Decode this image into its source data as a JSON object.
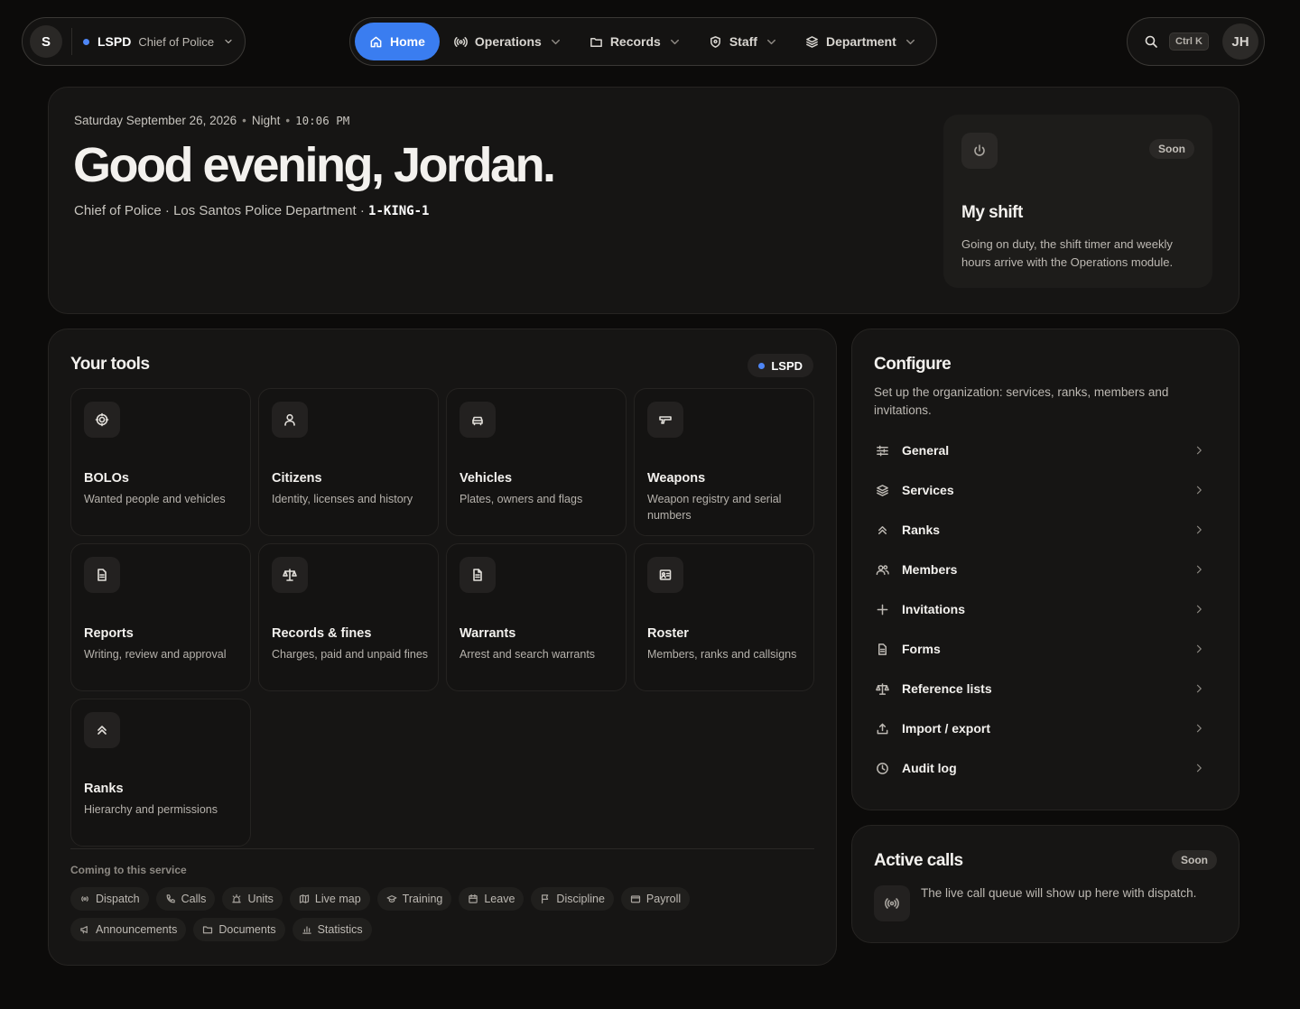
{
  "topbar": {
    "org_initial": "S",
    "org_code": "LSPD",
    "org_role": "Chief of Police",
    "nav": [
      {
        "label": "Home",
        "icon": "home-icon"
      },
      {
        "label": "Operations",
        "icon": "broadcast-icon"
      },
      {
        "label": "Records",
        "icon": "folder-icon"
      },
      {
        "label": "Staff",
        "icon": "shield-icon"
      },
      {
        "label": "Department",
        "icon": "layers-icon"
      }
    ],
    "shortcut": "Ctrl K",
    "user_initials": "JH"
  },
  "hero": {
    "date": "Saturday September 26, 2026",
    "period": "Night",
    "time": "10:06 PM",
    "greeting": "Good evening, Jordan.",
    "role": "Chief of Police",
    "department": "Los Santos Police Department",
    "callsign": "1-KING-1",
    "shift": {
      "badge": "Soon",
      "title": "My shift",
      "description": "Going on duty, the shift timer and weekly hours arrive with the Operations module."
    }
  },
  "tools": {
    "title": "Your tools",
    "badge": "LSPD",
    "items": [
      {
        "title": "BOLOs",
        "desc": "Wanted people and vehicles",
        "icon": "target-icon"
      },
      {
        "title": "Citizens",
        "desc": "Identity, licenses and history",
        "icon": "user-icon"
      },
      {
        "title": "Vehicles",
        "desc": "Plates, owners and flags",
        "icon": "car-icon"
      },
      {
        "title": "Weapons",
        "desc": "Weapon registry and serial numbers",
        "icon": "gun-icon"
      },
      {
        "title": "Reports",
        "desc": "Writing, review and approval",
        "icon": "document-icon"
      },
      {
        "title": "Records & fines",
        "desc": "Charges, paid and unpaid fines",
        "icon": "scale-icon"
      },
      {
        "title": "Warrants",
        "desc": "Arrest and search warrants",
        "icon": "file-text-icon"
      },
      {
        "title": "Roster",
        "desc": "Members, ranks and callsigns",
        "icon": "id-card-icon"
      },
      {
        "title": "Ranks",
        "desc": "Hierarchy and permissions",
        "icon": "chevrons-up-icon"
      }
    ],
    "coming_label": "Coming to this service",
    "coming": [
      {
        "label": "Dispatch",
        "icon": "broadcast-icon"
      },
      {
        "label": "Calls",
        "icon": "phone-icon"
      },
      {
        "label": "Units",
        "icon": "siren-icon"
      },
      {
        "label": "Live map",
        "icon": "map-icon"
      },
      {
        "label": "Training",
        "icon": "graduation-cap-icon"
      },
      {
        "label": "Leave",
        "icon": "calendar-icon"
      },
      {
        "label": "Discipline",
        "icon": "flag-icon"
      },
      {
        "label": "Payroll",
        "icon": "wallet-icon"
      },
      {
        "label": "Announcements",
        "icon": "megaphone-icon"
      },
      {
        "label": "Documents",
        "icon": "folder-icon"
      },
      {
        "label": "Statistics",
        "icon": "bar-chart-icon"
      }
    ]
  },
  "configure": {
    "title": "Configure",
    "description": "Set up the organization: services, ranks, members and invitations.",
    "items": [
      {
        "label": "General",
        "icon": "sliders-icon"
      },
      {
        "label": "Services",
        "icon": "layers-icon"
      },
      {
        "label": "Ranks",
        "icon": "chevrons-up-icon"
      },
      {
        "label": "Members",
        "icon": "users-icon"
      },
      {
        "label": "Invitations",
        "icon": "plus-icon"
      },
      {
        "label": "Forms",
        "icon": "document-icon"
      },
      {
        "label": "Reference lists",
        "icon": "scale-icon"
      },
      {
        "label": "Import / export",
        "icon": "upload-icon"
      },
      {
        "label": "Audit log",
        "icon": "clock-icon"
      }
    ]
  },
  "active_calls": {
    "title": "Active calls",
    "badge": "Soon",
    "description": "The live call queue will show up here with dispatch."
  },
  "colors": {
    "accent": "#3a7df0",
    "org_dot": "#4e86f5",
    "background": "#0c0b0a",
    "card": "#161514"
  }
}
